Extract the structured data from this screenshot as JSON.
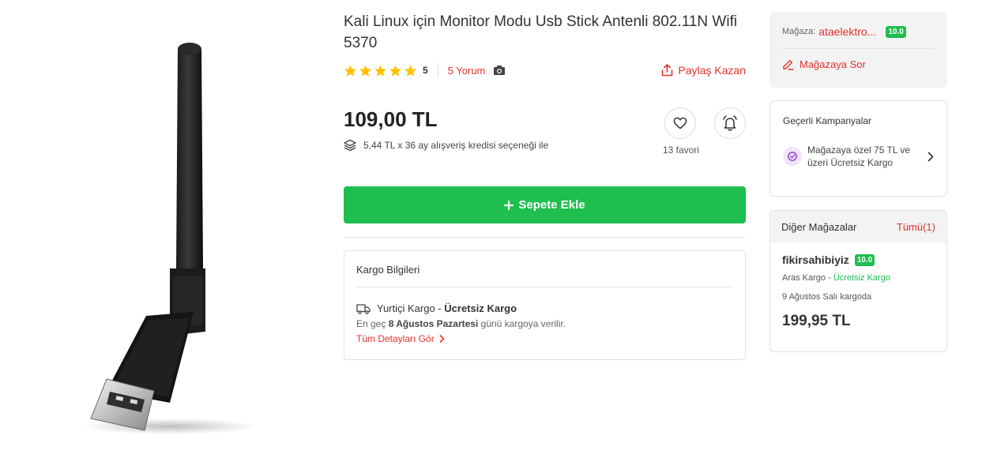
{
  "product": {
    "title": "Kali Linux için Monitor Modu Usb Stick Antenli 802.11N Wifi 5370",
    "rating": "5",
    "reviews_label": "5 Yorum",
    "share_label": "Paylaş Kazan",
    "price": "109,00 TL",
    "credit_text": "5,44 TL x 36 ay alışveriş kredisi seçeneği ile",
    "favorites": "13 favori",
    "add_to_cart_label": "Sepete Ekle",
    "image_icon": "usb-wifi-antenna-image"
  },
  "cargo": {
    "title": "Kargo Bilgileri",
    "domestic_label": "Yurtiçi Kargo",
    "dash": " - ",
    "free_label": "Ücretsiz Kargo",
    "note_prefix": "En geç ",
    "note_date": "8 Ağustos Pazartesi",
    "note_suffix": " günü kargoya verilir.",
    "details_link": "Tüm Detayları Gör"
  },
  "store": {
    "label": "Mağaza:",
    "name": "ataelektro...",
    "score": "10.0",
    "ask_label": "Mağazaya Sor"
  },
  "campaigns": {
    "title": "Geçerli Kampanyalar",
    "item": "Mağazaya özel 75 TL ve üzeri Ücretsiz Kargo"
  },
  "other_stores": {
    "title": "Diğer Mağazalar",
    "all_label": "Tümü(1)",
    "seller_name": "fikirsahibiyiz",
    "seller_score": "10.0",
    "cargo_company": "Aras Kargo",
    "cargo_sep": " - ",
    "cargo_free": "Ücretsiz Kargo",
    "delivery_text": "9 Ağustos Salı kargoda",
    "price": "199,95 TL"
  },
  "colors": {
    "accent": "#e0332c",
    "green": "#1ebe4f",
    "star": "#ffc000"
  }
}
